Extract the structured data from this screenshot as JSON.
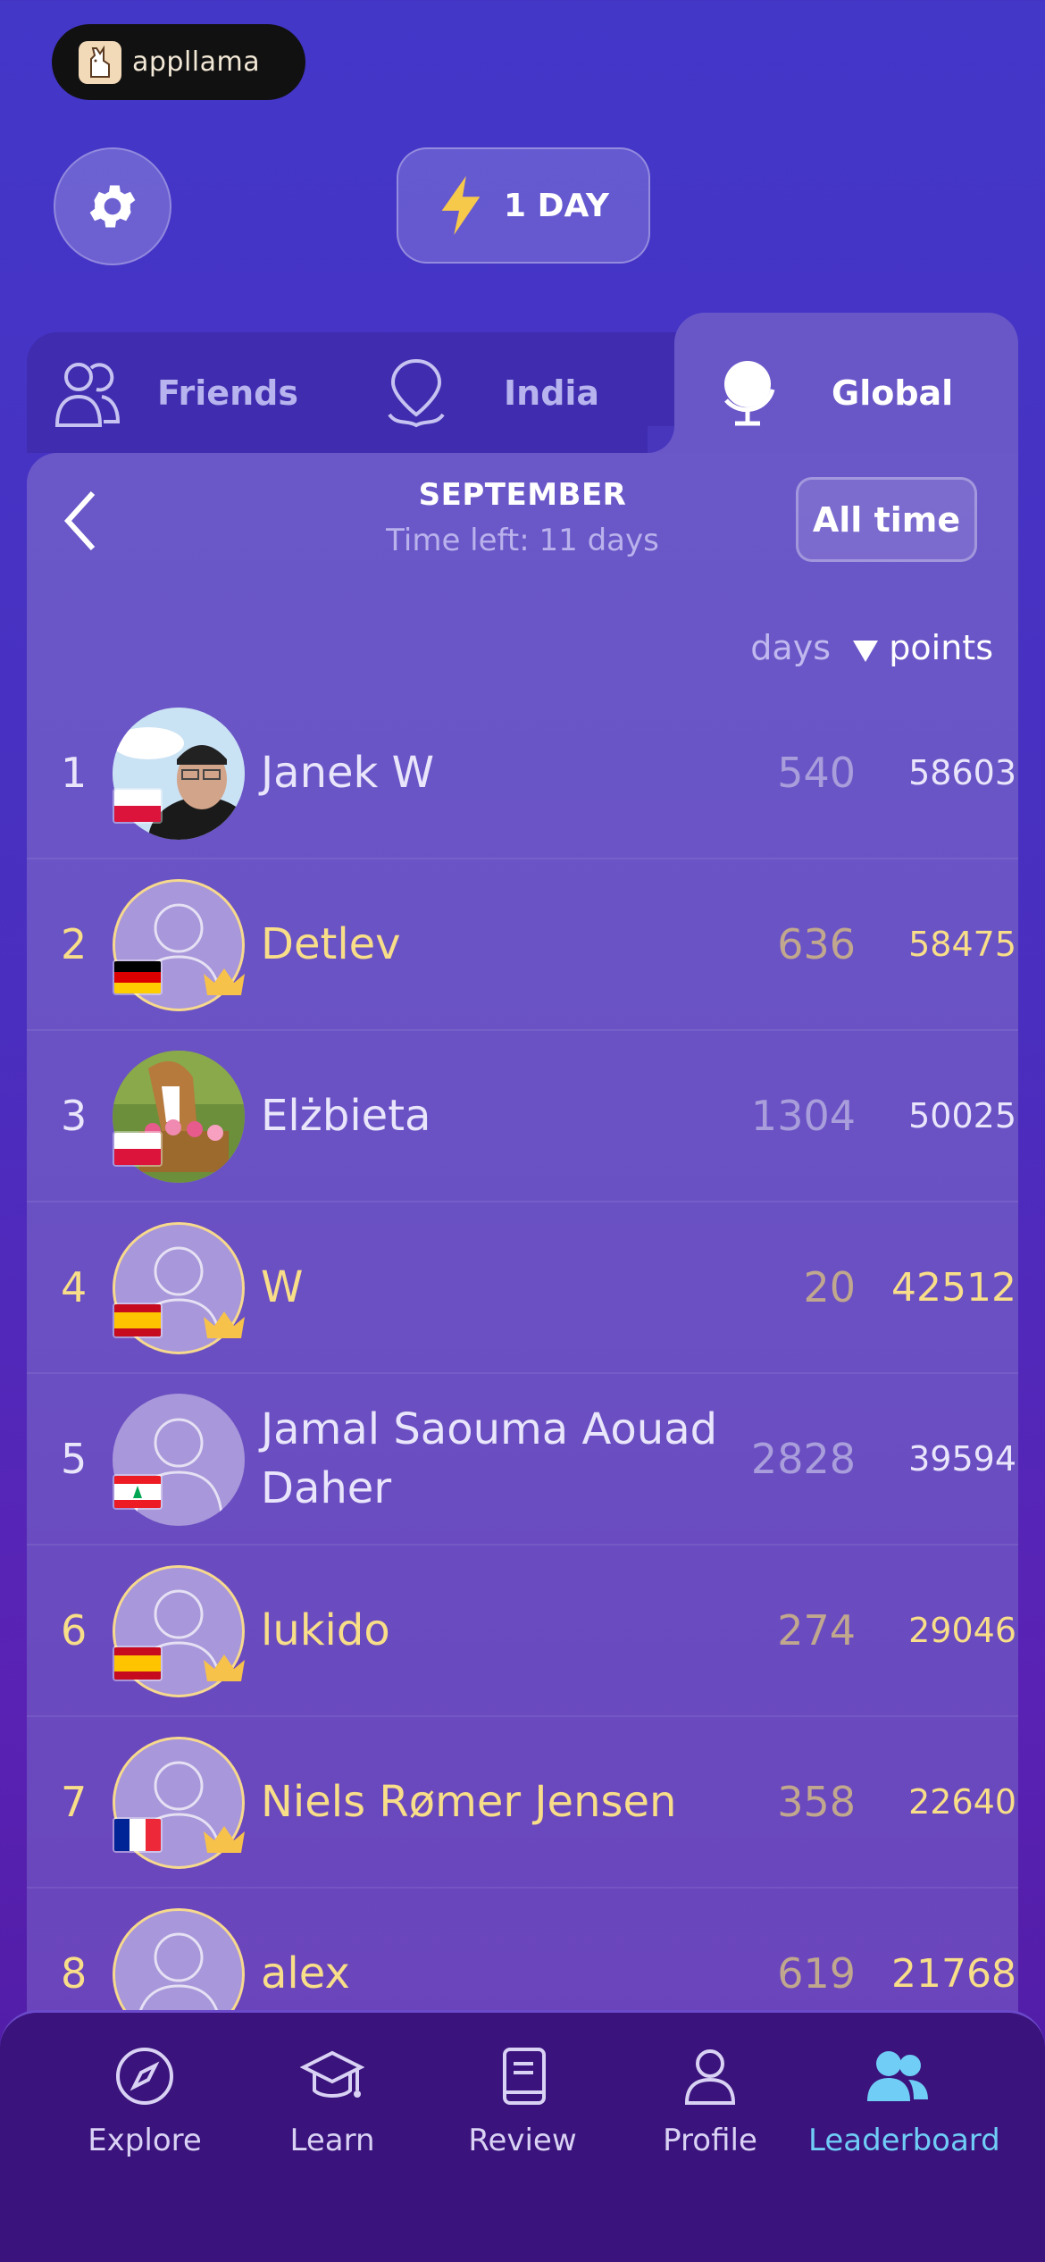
{
  "brand": {
    "name": "appllama"
  },
  "header": {
    "streak_label": "1 DAY"
  },
  "tabs": [
    {
      "label": "Friends",
      "icon": "friends-icon"
    },
    {
      "label": "India",
      "icon": "map-pin-icon"
    },
    {
      "label": "Global",
      "icon": "globe-icon",
      "active": true
    }
  ],
  "period": {
    "month": "SEPTEMBER",
    "time_left": "Time left: 11 days",
    "all_time_label": "All time"
  },
  "columns": {
    "days": "days",
    "points": "points"
  },
  "leaderboard": [
    {
      "rank": "1",
      "name": "Janek W",
      "days": "540",
      "points": "58603",
      "flag": "Poland",
      "premium": false
    },
    {
      "rank": "2",
      "name": "Detlev",
      "days": "636",
      "points": "58475",
      "flag": "Germany",
      "premium": true
    },
    {
      "rank": "3",
      "name": "Elżbieta",
      "days": "1304",
      "points": "50025",
      "flag": "Poland",
      "premium": false
    },
    {
      "rank": "4",
      "name": "W",
      "days": "20",
      "points": "42512",
      "flag": "Spain",
      "premium": true
    },
    {
      "rank": "5",
      "name": "Jamal Saouma Aouad Daher",
      "days": "2828",
      "points": "39594",
      "flag": "Lebanon",
      "premium": false
    },
    {
      "rank": "6",
      "name": "lukido",
      "days": "274",
      "points": "29046",
      "flag": "Spain",
      "premium": true
    },
    {
      "rank": "7",
      "name": "Niels Rømer Jensen",
      "days": "358",
      "points": "22640",
      "flag": "France",
      "premium": true
    },
    {
      "rank": "8",
      "name": "alex",
      "days": "619",
      "points": "21768",
      "flag": "",
      "premium": true
    }
  ],
  "nav": [
    {
      "label": "Explore",
      "icon": "compass-icon"
    },
    {
      "label": "Learn",
      "icon": "graduation-cap-icon"
    },
    {
      "label": "Review",
      "icon": "book-icon"
    },
    {
      "label": "Profile",
      "icon": "user-icon"
    },
    {
      "label": "Leaderboard",
      "icon": "users-icon",
      "active": true
    }
  ],
  "colors": {
    "accent_gold": "#f8de88",
    "nav_active": "#6fcdf6"
  }
}
